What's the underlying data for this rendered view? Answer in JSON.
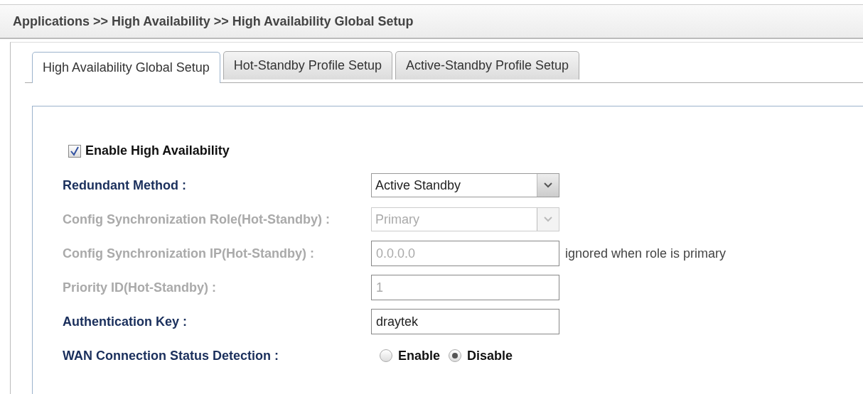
{
  "breadcrumb": "Applications >> High Availability >> High Availability Global Setup",
  "tabs": [
    {
      "label": "High Availability Global Setup",
      "selected": true
    },
    {
      "label": "Hot-Standby Profile Setup",
      "selected": false
    },
    {
      "label": "Active-Standby Profile Setup",
      "selected": false
    }
  ],
  "enable": {
    "label": "Enable High Availability",
    "checked": true
  },
  "fields": [
    {
      "kind": "select",
      "label": "Redundant Method :",
      "value": "Active Standby",
      "disabled": false
    },
    {
      "kind": "select",
      "label": "Config Synchronization Role(Hot-Standby) :",
      "value": "Primary",
      "disabled": true
    },
    {
      "kind": "text",
      "label": "Config Synchronization IP(Hot-Standby) :",
      "value": "0.0.0.0",
      "disabled": true,
      "note": "ignored when role is primary"
    },
    {
      "kind": "text",
      "label": "Priority ID(Hot-Standby) :",
      "value": "1",
      "disabled": true
    },
    {
      "kind": "text",
      "label": "Authentication Key :",
      "value": "draytek",
      "disabled": false
    },
    {
      "kind": "radio",
      "label": "WAN Connection Status Detection :",
      "disabled": false,
      "options": [
        {
          "label": "Enable",
          "selected": false
        },
        {
          "label": "Disable",
          "selected": true
        }
      ]
    }
  ]
}
